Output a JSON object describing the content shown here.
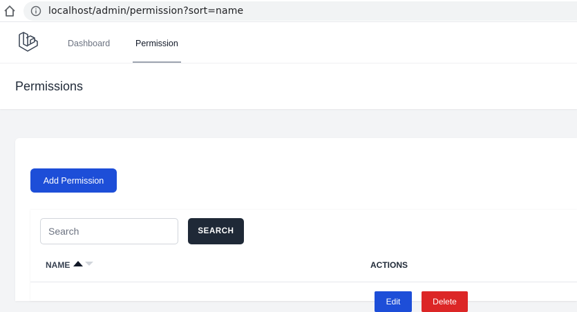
{
  "browser": {
    "url": "localhost/admin/permission?sort=name",
    "icons": {
      "home": "home-icon",
      "info": "info-icon"
    }
  },
  "nav": {
    "logo": "laravel-logo",
    "items": [
      {
        "label": "Dashboard",
        "active": false
      },
      {
        "label": "Permission",
        "active": true
      }
    ]
  },
  "page": {
    "title": "Permissions"
  },
  "toolbar": {
    "add_label": "Add Permission"
  },
  "search": {
    "placeholder": "Search",
    "value": "",
    "button_label": "SEARCH"
  },
  "table": {
    "columns": [
      {
        "label": "NAME",
        "sort": "ascending"
      },
      {
        "label": "ACTIONS"
      }
    ],
    "rows": [
      {
        "name": "",
        "edit_label": "Edit",
        "delete_label": "Delete"
      }
    ]
  },
  "colors": {
    "primary": "#1d4ed8",
    "danger": "#dc2626",
    "dark_button": "#1f2937",
    "page_bg": "#f3f4f6"
  }
}
